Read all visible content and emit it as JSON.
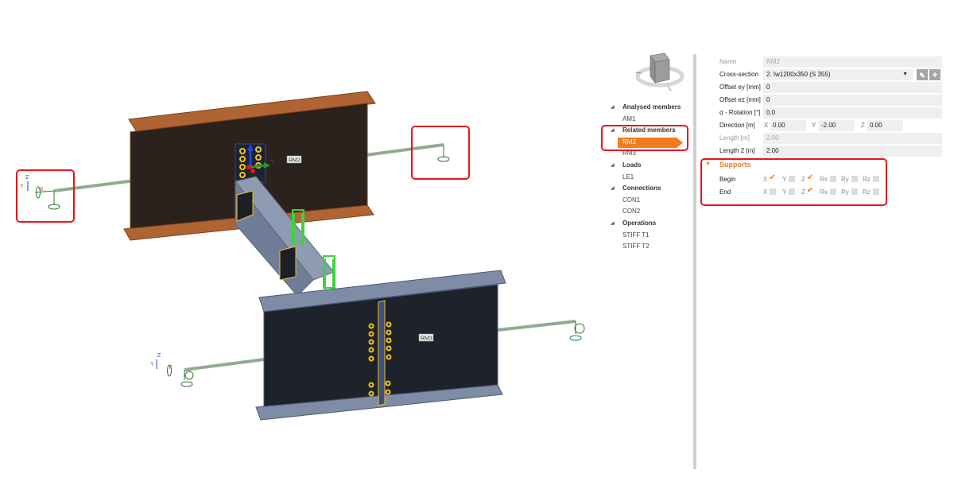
{
  "viewport": {
    "member_labels": [
      {
        "id": "rm2",
        "text": "RM2"
      },
      {
        "id": "rm3",
        "text": "RM3"
      }
    ],
    "axis_labels": {
      "x": "X",
      "y": "Y",
      "z": "Z"
    },
    "colors": {
      "beam_top_flange": "#a0522d",
      "beam_web_dark": "#2a1f1a",
      "beam_blue_grey": "#7b8aa2",
      "web_dark_blue": "#1e222b",
      "bolts": "#f2c31a",
      "loads": "#3bd43b",
      "member_line": "#8dbf8d",
      "highlight": "#e8151c"
    }
  },
  "navigator": {
    "icon": "view-cube-icon"
  },
  "tree": {
    "groups": [
      {
        "label": "Analysed members",
        "items": [
          {
            "label": "AM1",
            "selected": false
          }
        ]
      },
      {
        "label": "Related members",
        "items": [
          {
            "label": "RM2",
            "selected": true
          },
          {
            "label": "RM3",
            "selected": false
          }
        ]
      },
      {
        "label": "Loads",
        "items": [
          {
            "label": "LE1",
            "selected": false
          }
        ]
      },
      {
        "label": "Connections",
        "items": [
          {
            "label": "CON1",
            "selected": false
          },
          {
            "label": "CON2",
            "selected": false
          }
        ]
      },
      {
        "label": "Operations",
        "items": [
          {
            "label": "STIFF T1",
            "selected": false
          },
          {
            "label": "STIFF T2",
            "selected": false
          }
        ]
      }
    ],
    "selected_color": "#f07c1f"
  },
  "properties": {
    "name": {
      "label": "Name",
      "value": "RM2"
    },
    "cross_section": {
      "label": "Cross-section",
      "value": "2. Iw1200x350 (S 355)"
    },
    "offset_ey": {
      "label": "Offset ey [mm]",
      "value": "0"
    },
    "offset_ez": {
      "label": "Offset ez [mm]",
      "value": "0"
    },
    "rotation": {
      "label": "α - Rotation [°]",
      "value": "0.0"
    },
    "direction": {
      "label": "Direction [m]",
      "x_label": "X",
      "x": "0.00",
      "y_label": "Y",
      "y": "-2.00",
      "z_label": "Z",
      "z": "0.00"
    },
    "length": {
      "label": "Length [m]",
      "value": "2.00"
    },
    "length2": {
      "label": "Length 2 [m]",
      "value": "2.00"
    }
  },
  "supports": {
    "title": "Supports",
    "axes": [
      "X",
      "Y",
      "Z",
      "Rx",
      "Ry",
      "Rz"
    ],
    "rows": [
      {
        "label": "Begin",
        "checked": [
          true,
          false,
          true,
          false,
          false,
          false
        ]
      },
      {
        "label": "End",
        "checked": [
          false,
          false,
          true,
          false,
          false,
          false
        ]
      }
    ]
  }
}
